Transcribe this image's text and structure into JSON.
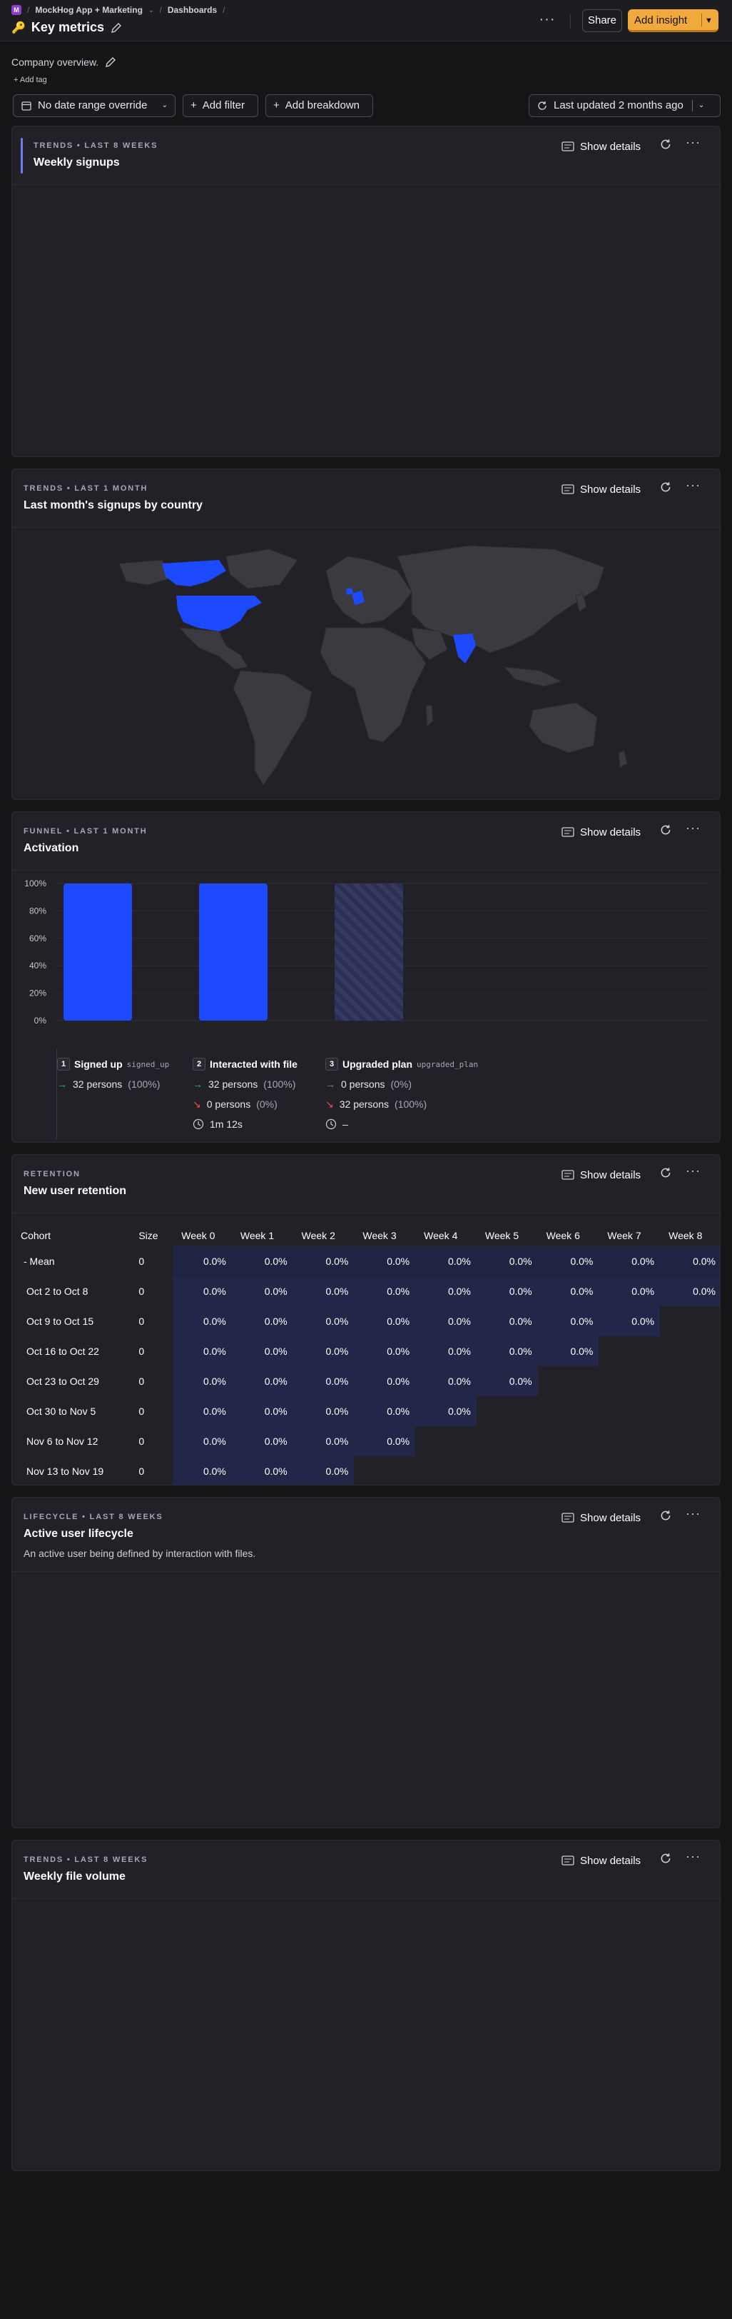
{
  "breadcrumb": {
    "project_initial": "M",
    "project": "MockHog App + Marketing",
    "section": "Dashboards"
  },
  "page": {
    "title": "Key metrics",
    "title_icon": "key-icon",
    "description": "Company overview.",
    "add_tag": "Add tag"
  },
  "header": {
    "share_label": "Share",
    "add_insight_label": "Add insight"
  },
  "filters": {
    "date_range_label": "No date range override",
    "add_filter_label": "Add filter",
    "add_breakdown_label": "Add breakdown",
    "last_updated_label": "Last updated 2 months ago"
  },
  "common": {
    "show_details": "Show details"
  },
  "colors": {
    "accent": "#f2a93b",
    "series_blue": "#1d4aff",
    "map_land": "#3a3a40"
  },
  "cards": [
    {
      "kicker": "TRENDS • LAST 8 WEEKS",
      "title": "Weekly signups"
    },
    {
      "kicker": "TRENDS • LAST 1 MONTH",
      "title": "Last month's signups by country"
    },
    {
      "kicker": "FUNNEL • LAST 1 MONTH",
      "title": "Activation"
    },
    {
      "kicker": "RETENTION",
      "title": "New user retention"
    },
    {
      "kicker": "LIFECYCLE • LAST 8 WEEKS",
      "title": "Active user lifecycle",
      "subtitle": "An active user being defined by interaction with files."
    },
    {
      "kicker": "TRENDS • LAST 8 WEEKS",
      "title": "Weekly file volume"
    }
  ],
  "map": {
    "highlighted_countries": [
      "United States",
      "Canada",
      "Germany",
      "Netherlands",
      "India"
    ]
  },
  "chart_data": {
    "type": "bar",
    "categories": [
      "Signed up",
      "Interacted with file",
      "Upgraded plan"
    ],
    "values": [
      100,
      100,
      0
    ],
    "ylim": [
      0,
      100
    ],
    "y_ticks": [
      "100%",
      "80%",
      "60%",
      "40%",
      "20%",
      "0%"
    ],
    "grid": true
  },
  "funnel_steps": [
    {
      "num": "1",
      "name": "Signed up",
      "event": "signed_up",
      "converted": "32 persons",
      "converted_pct": "(100%)"
    },
    {
      "num": "2",
      "name": "Interacted with file",
      "event": "",
      "converted": "32 persons",
      "converted_pct": "(100%)",
      "dropped": "0 persons",
      "dropped_pct": "(0%)",
      "time": "1m 12s"
    },
    {
      "num": "3",
      "name": "Upgraded plan",
      "event": "upgraded_plan",
      "converted": "0 persons",
      "converted_pct": "(0%)",
      "dropped": "32 persons",
      "dropped_pct": "(100%)",
      "time": "–"
    }
  ],
  "retention": {
    "columns": [
      "Cohort",
      "Size",
      "Week 0",
      "Week 1",
      "Week 2",
      "Week 3",
      "Week 4",
      "Week 5",
      "Week 6",
      "Week 7",
      "Week 8"
    ],
    "mean_label": "Mean",
    "mean_size": "0",
    "mean_values": [
      "0.0%",
      "0.0%",
      "0.0%",
      "0.0%",
      "0.0%",
      "0.0%",
      "0.0%",
      "0.0%",
      "0.0%"
    ],
    "rows": [
      {
        "cohort": "Oct 2 to Oct 8",
        "size": "0",
        "values": [
          "0.0%",
          "0.0%",
          "0.0%",
          "0.0%",
          "0.0%",
          "0.0%",
          "0.0%",
          "0.0%",
          "0.0%"
        ]
      },
      {
        "cohort": "Oct 9 to Oct 15",
        "size": "0",
        "values": [
          "0.0%",
          "0.0%",
          "0.0%",
          "0.0%",
          "0.0%",
          "0.0%",
          "0.0%",
          "0.0%"
        ]
      },
      {
        "cohort": "Oct 16 to Oct 22",
        "size": "0",
        "values": [
          "0.0%",
          "0.0%",
          "0.0%",
          "0.0%",
          "0.0%",
          "0.0%",
          "0.0%"
        ]
      },
      {
        "cohort": "Oct 23 to Oct 29",
        "size": "0",
        "values": [
          "0.0%",
          "0.0%",
          "0.0%",
          "0.0%",
          "0.0%",
          "0.0%"
        ]
      },
      {
        "cohort": "Oct 30 to Nov 5",
        "size": "0",
        "values": [
          "0.0%",
          "0.0%",
          "0.0%",
          "0.0%",
          "0.0%"
        ]
      },
      {
        "cohort": "Nov 6 to Nov 12",
        "size": "0",
        "values": [
          "0.0%",
          "0.0%",
          "0.0%",
          "0.0%"
        ]
      },
      {
        "cohort": "Nov 13 to Nov 19",
        "size": "0",
        "values": [
          "0.0%",
          "0.0%",
          "0.0%"
        ]
      }
    ]
  }
}
